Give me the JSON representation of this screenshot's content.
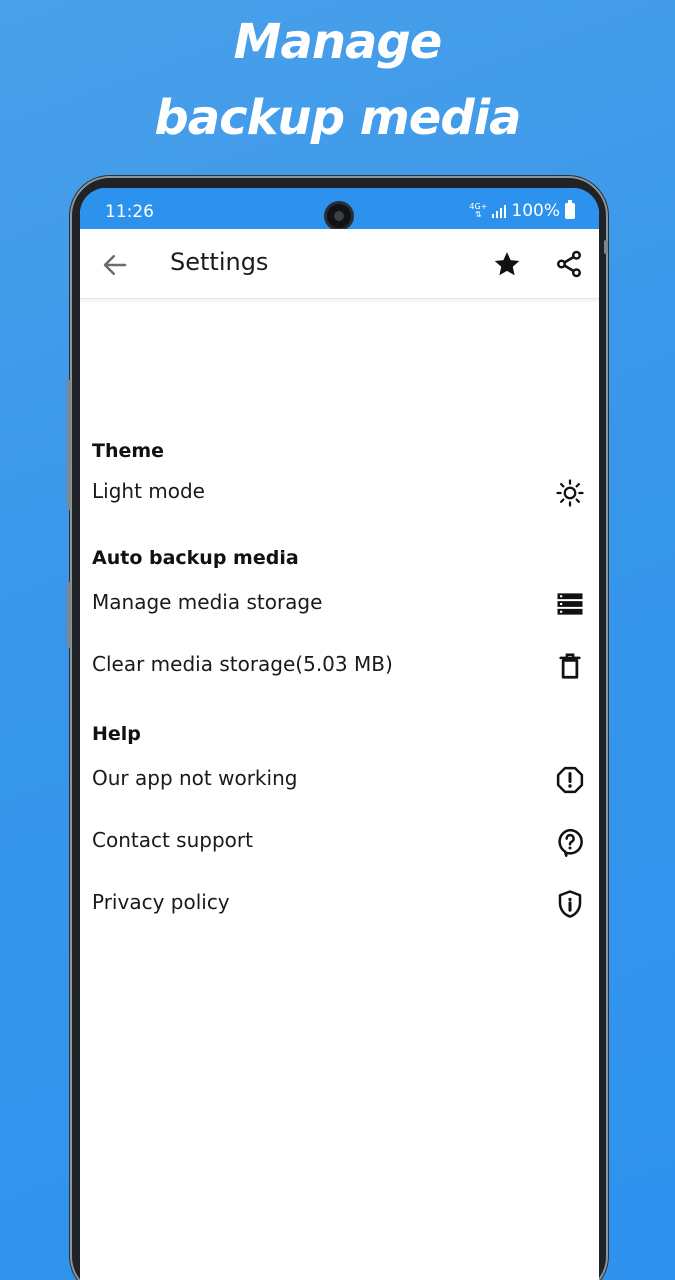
{
  "promo": {
    "line1": "Manage",
    "line2": "backup media"
  },
  "status_bar": {
    "time": "11:26",
    "network": "4G+",
    "battery": "100%"
  },
  "app_bar": {
    "title": "Settings",
    "icons": [
      "back-arrow-icon",
      "star-icon",
      "share-icon"
    ]
  },
  "sections": {
    "theme": {
      "title": "Theme",
      "items": [
        {
          "label": "Light mode",
          "icon": "sun-icon"
        }
      ]
    },
    "backup": {
      "title": "Auto backup media",
      "items": [
        {
          "label": "Manage media storage",
          "icon": "storage-icon"
        },
        {
          "label": "Clear media storage(5.03 MB)",
          "icon": "trash-icon"
        }
      ]
    },
    "help": {
      "title": "Help",
      "items": [
        {
          "label": "Our app not working",
          "icon": "alert-octagon-icon"
        },
        {
          "label": "Contact support",
          "icon": "help-chat-icon"
        },
        {
          "label": "Privacy policy",
          "icon": "shield-info-icon"
        }
      ]
    }
  },
  "colors": {
    "background": "#3796ea",
    "status_bar": "#2d92ee",
    "screen": "#ffffff",
    "text": "#1a1a1a"
  }
}
